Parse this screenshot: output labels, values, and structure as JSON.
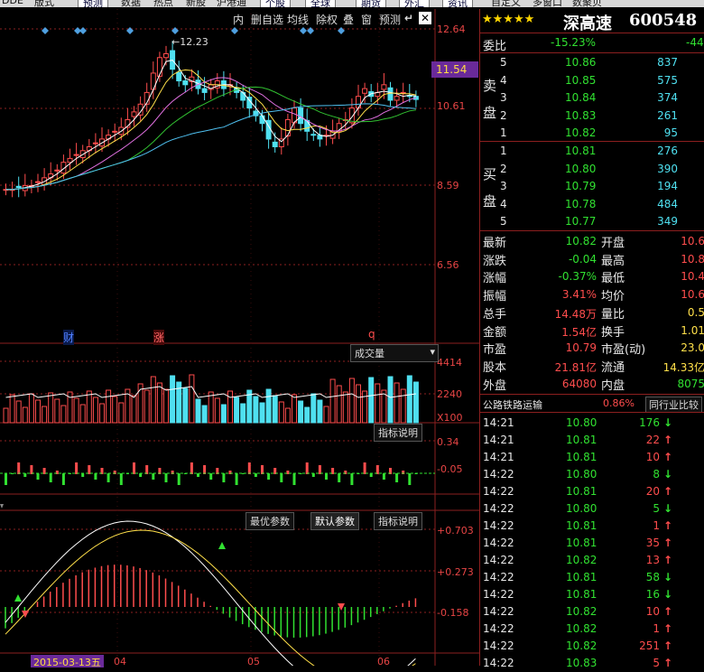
{
  "menubar": {
    "items": [
      "DDE",
      "版式",
      "预测",
      "数据",
      "热点",
      "新股",
      "沪港通",
      "个股",
      "全球",
      "期货",
      "外汇",
      "资讯",
      "自定义",
      "多窗口",
      "数聚贝"
    ]
  },
  "toolbar": {
    "items": [
      "内",
      "删自选",
      "均线",
      "除权",
      "叠",
      "窗",
      "预测"
    ],
    "back_label": "↵",
    "close_label": "✕"
  },
  "price_axis": [
    "12.64",
    "11.54",
    "10.61",
    "8.59",
    "6.56"
  ],
  "current_price_tag": "11.54",
  "high_annotation": "←12.23",
  "event_markers": [
    "财",
    "涨",
    "q"
  ],
  "volume_panel": {
    "label": "成交量",
    "axis": [
      "4414",
      "2240",
      "X100"
    ],
    "indicator_button": "指标说明"
  },
  "macd_small_panel": {
    "axis": [
      "0.34",
      "-0.05"
    ]
  },
  "macd_panel": {
    "buttons": [
      "最优参数",
      "默认参数",
      "指标说明"
    ],
    "axis": [
      "+0.703",
      "+0.273",
      "-0.158"
    ]
  },
  "date_axis": [
    "2015-03-13五",
    "04",
    "05",
    "06"
  ],
  "quote": {
    "stars": "★★★★★",
    "stock_name": "深高速",
    "stock_code": "600548",
    "weibi_label": "委比",
    "weibi_value": "-15.23%",
    "weibi_diff": "-44",
    "sell_label": "卖盘",
    "buy_label": "买盘",
    "sell": [
      {
        "level": "5",
        "price": "10.86",
        "vol": "837"
      },
      {
        "level": "4",
        "price": "10.85",
        "vol": "575"
      },
      {
        "level": "3",
        "price": "10.84",
        "vol": "374"
      },
      {
        "level": "2",
        "price": "10.83",
        "vol": "261"
      },
      {
        "level": "1",
        "price": "10.82",
        "vol": "95"
      }
    ],
    "buy": [
      {
        "level": "1",
        "price": "10.81",
        "vol": "276"
      },
      {
        "level": "2",
        "price": "10.80",
        "vol": "390"
      },
      {
        "level": "3",
        "price": "10.79",
        "vol": "194"
      },
      {
        "level": "4",
        "price": "10.78",
        "vol": "484"
      },
      {
        "level": "5",
        "price": "10.77",
        "vol": "349"
      }
    ],
    "stats": [
      {
        "l1": "最新",
        "v1": "10.82",
        "l2": "开盘",
        "v2": "10.6"
      },
      {
        "l1": "涨跌",
        "v1": "-0.04",
        "l2": "最高",
        "v2": "10.8"
      },
      {
        "l1": "涨幅",
        "v1": "-0.37%",
        "l2": "最低",
        "v2": "10.4"
      },
      {
        "l1": "振幅",
        "v1": "3.41%",
        "l2": "均价",
        "v2": "10.6"
      },
      {
        "l1": "总手",
        "v1": "14.48万",
        "l2": "量比",
        "v2": "0.5"
      },
      {
        "l1": "金额",
        "v1": "1.54亿",
        "l2": "换手",
        "v2": "1.01"
      },
      {
        "l1": "市盈",
        "v1": "10.79",
        "l2": "市盈(动)",
        "v2": "23.0"
      },
      {
        "l1": "股本",
        "v1": "21.81亿",
        "l2": "流通",
        "v2": "14.33亿"
      },
      {
        "l1": "外盘",
        "v1": "64080",
        "l2": "内盘",
        "v2": "8075"
      }
    ],
    "sector_name": "公路铁路运输",
    "sector_change": "0.86%",
    "compare_button": "同行业比较",
    "ticks": [
      {
        "time": "14:21",
        "price": "10.80",
        "vol": "176",
        "dir": "down"
      },
      {
        "time": "14:21",
        "price": "10.81",
        "vol": "22",
        "dir": "up"
      },
      {
        "time": "14:21",
        "price": "10.81",
        "vol": "10",
        "dir": "up"
      },
      {
        "time": "14:22",
        "price": "10.80",
        "vol": "8",
        "dir": "down"
      },
      {
        "time": "14:22",
        "price": "10.81",
        "vol": "20",
        "dir": "up"
      },
      {
        "time": "14:22",
        "price": "10.80",
        "vol": "5",
        "dir": "down"
      },
      {
        "time": "14:22",
        "price": "10.81",
        "vol": "1",
        "dir": "up"
      },
      {
        "time": "14:22",
        "price": "10.81",
        "vol": "35",
        "dir": "up"
      },
      {
        "time": "14:22",
        "price": "10.82",
        "vol": "13",
        "dir": "up"
      },
      {
        "time": "14:22",
        "price": "10.81",
        "vol": "58",
        "dir": "down"
      },
      {
        "time": "14:22",
        "price": "10.81",
        "vol": "16",
        "dir": "down"
      },
      {
        "time": "14:22",
        "price": "10.82",
        "vol": "10",
        "dir": "up"
      },
      {
        "time": "14:22",
        "price": "10.82",
        "vol": "1",
        "dir": "up"
      },
      {
        "time": "14:22",
        "price": "10.82",
        "vol": "251",
        "dir": "up"
      },
      {
        "time": "14:22",
        "price": "10.83",
        "vol": "5",
        "dir": "up"
      }
    ]
  },
  "colors": {
    "up": "#ff4d4d",
    "down": "#31e131",
    "cyan": "#4fe0f0",
    "grid": "#8c1f1f",
    "ma1": "#ffffff",
    "ma2": "#ffe04a",
    "ma3": "#e070e0",
    "ma4": "#31c131",
    "ma5": "#4fc0f0"
  }
}
